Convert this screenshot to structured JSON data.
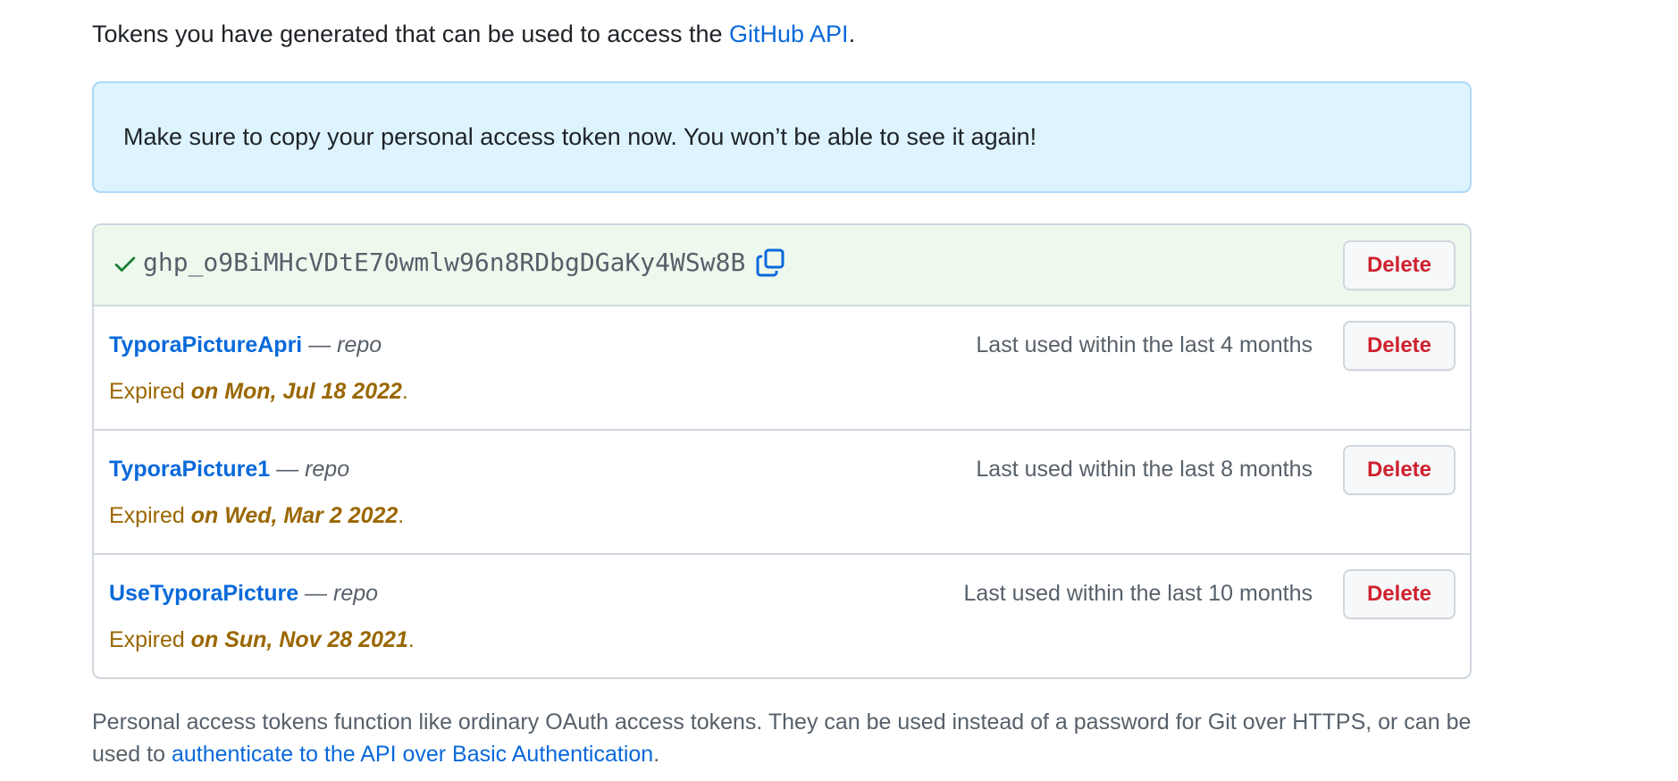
{
  "intro": {
    "text": "Tokens you have generated that can be used to access the ",
    "link": "GitHub API",
    "suffix": "."
  },
  "flash": {
    "message": "Make sure to copy your personal access token now. You won’t be able to see it again!"
  },
  "new_token": {
    "value": "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",
    "delete_label": "Delete",
    "status_color": "#1a7f37"
  },
  "tokens": [
    {
      "name": "TyporaPictureApri",
      "dash": " — ",
      "scope": "repo",
      "last_used": "Last used within the last 4 months",
      "expired_prefix": "Expired ",
      "expired_date": "on Mon, Jul 18 2022",
      "expired_suffix": ".",
      "delete_label": "Delete"
    },
    {
      "name": "TyporaPicture1",
      "dash": " — ",
      "scope": "repo",
      "last_used": "Last used within the last 8 months",
      "expired_prefix": "Expired ",
      "expired_date": "on Wed, Mar 2 2022",
      "expired_suffix": ".",
      "delete_label": "Delete"
    },
    {
      "name": "UseTyporaPicture",
      "dash": " — ",
      "scope": "repo",
      "last_used": "Last used within the last 10 months",
      "expired_prefix": "Expired ",
      "expired_date": "on Sun, Nov 28 2021",
      "expired_suffix": ".",
      "delete_label": "Delete"
    }
  ],
  "footer_note": {
    "text": "Personal access tokens function like ordinary OAuth access tokens. They can be used instead of a password for Git over HTTPS, or can be used to ",
    "link": "authenticate to the API over Basic Authentication",
    "suffix": "."
  },
  "colors": {
    "link": "#0969da",
    "danger": "#cf222e",
    "expired": "#9a6700",
    "success": "#1a7f37",
    "flash_bg": "#ddf4ff",
    "new_token_bg": "#eef9ee"
  },
  "icons": {
    "check": "check-icon",
    "copy": "copy-icon"
  }
}
